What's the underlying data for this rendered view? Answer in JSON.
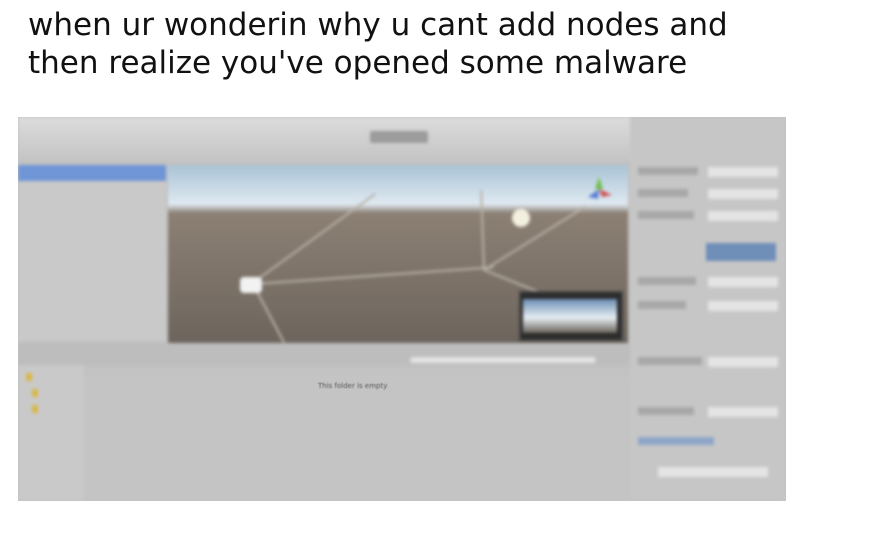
{
  "caption": {
    "line1": "when ur wonderin why u cant add nodes and",
    "line2": "then realize you've opened some malware"
  },
  "screenshot": {
    "project_panel": {
      "empty_message": "This folder is empty"
    }
  }
}
